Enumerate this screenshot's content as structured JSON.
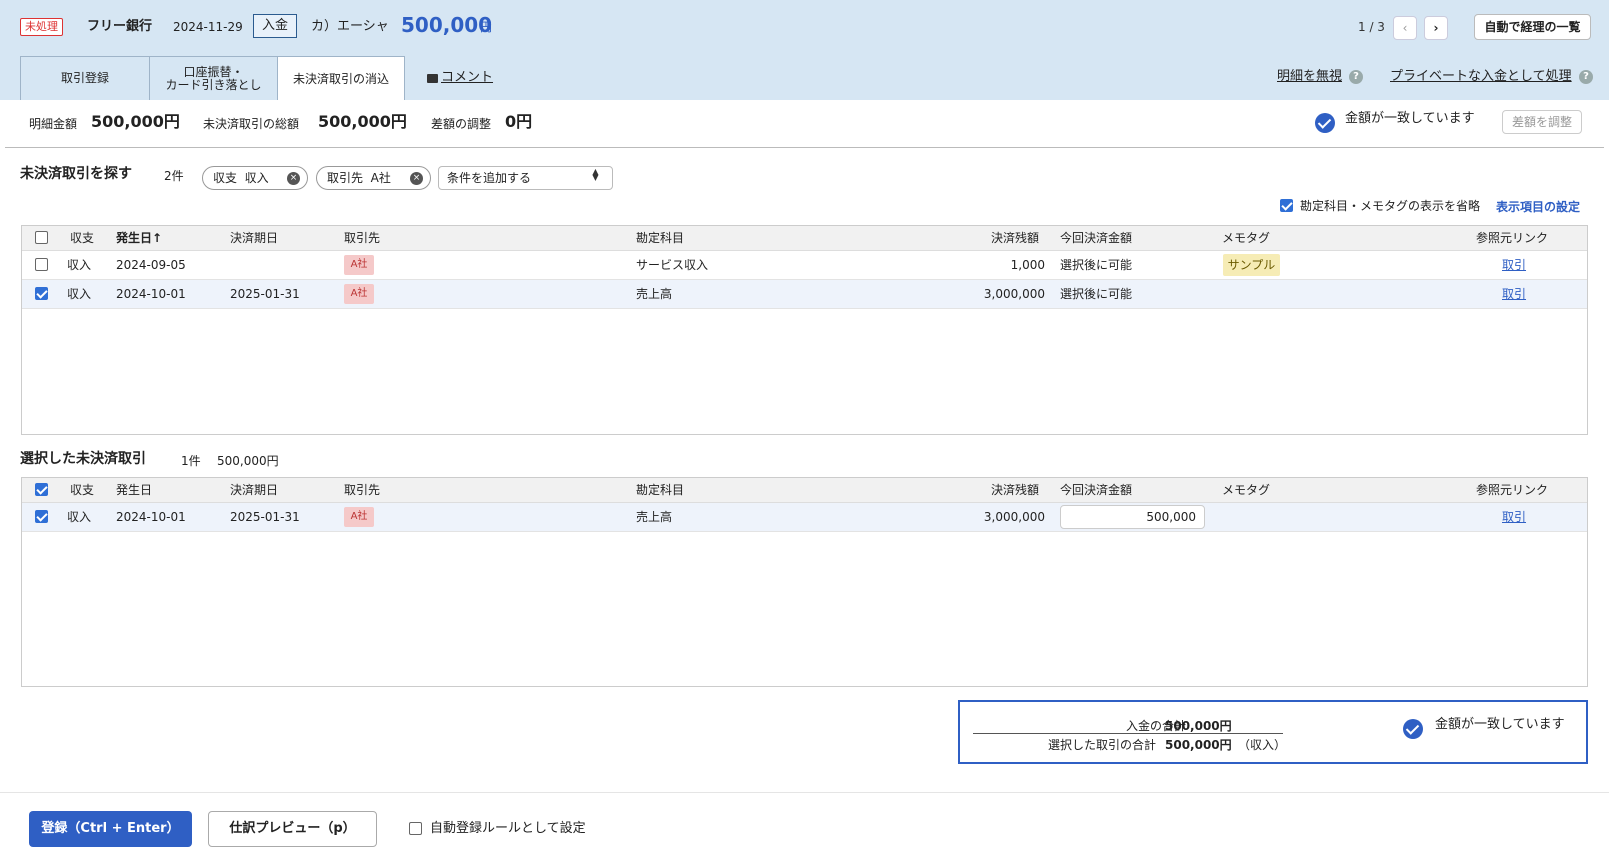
{
  "header": {
    "status_badge": "未処理",
    "bank_name": "フリー銀行",
    "date": "2024-11-29",
    "kind": "入金",
    "partner": "カ）エーシャ",
    "amount": "500,000",
    "yen": "円",
    "pager": "1 / 3",
    "prev_icon": "‹",
    "next_icon": "›",
    "list_button": "自動で経理の一覧"
  },
  "tabs": {
    "tab1": "取引登録",
    "tab2_line1": "口座振替・",
    "tab2_line2": "カード引き落とし",
    "tab3": "未決済取引の消込",
    "comment": "コメント",
    "ignore": "明細を無視",
    "private": "プライベートな入金として処理",
    "help_icon": "?"
  },
  "summary": {
    "detail_label": "明細金額",
    "detail_value": "500,000円",
    "total_label": "未決済取引の総額",
    "total_value": "500,000円",
    "diff_label": "差額の調整",
    "diff_value": "0円",
    "match_text": "金額が一致しています",
    "adjust_button": "差額を調整"
  },
  "search": {
    "title": "未決済取引を探す",
    "count": "2件",
    "chip1_label": "収支",
    "chip1_value": "収入",
    "chip2_label": "取引先",
    "chip2_value": "A社",
    "chip_remove": "×",
    "add_condition": "条件を追加する",
    "select_arrow": "▲▼",
    "omit_label": "勘定科目・メモタグの表示を省略",
    "column_setting": "表示項目の設定"
  },
  "columns": {
    "kind": "収支",
    "date": "発生日",
    "date_sort": "発生日↑",
    "due": "決済期日",
    "partner": "取引先",
    "account": "勘定科目",
    "remaining": "決済残額",
    "current": "今回決済金額",
    "memo": "メモタグ",
    "ref": "参照元リンク"
  },
  "search_rows": [
    {
      "kind": "収入",
      "date": "2024-09-05",
      "due": "",
      "partner": "A社",
      "account": "サービス収入",
      "remaining": "1,000",
      "current": "選択後に可能",
      "memo": "サンプル",
      "ref": "取引"
    },
    {
      "kind": "収入",
      "date": "2024-10-01",
      "due": "2025-01-31",
      "partner": "A社",
      "account": "売上高",
      "remaining": "3,000,000",
      "current": "選択後に可能",
      "memo": "",
      "ref": "取引"
    }
  ],
  "selected": {
    "title": "選択した未決済取引",
    "count": "1件",
    "amount": "500,000円",
    "rows": [
      {
        "kind": "収入",
        "date": "2024-10-01",
        "due": "2025-01-31",
        "partner": "A社",
        "account": "売上高",
        "remaining": "3,000,000",
        "current": "500,000",
        "memo": "",
        "ref": "取引"
      }
    ]
  },
  "totals": {
    "deposit_label": "入金の合計",
    "deposit_value": "500,000円",
    "selected_label": "選択した取引の合計",
    "selected_value": "500,000円",
    "selected_note": "（収入）",
    "match_text": "金額が一致しています"
  },
  "footer": {
    "register": "登録（Ctrl + Enter）",
    "preview": "仕訳プレビュー（p）",
    "auto_rule": "自動登録ルールとして設定"
  },
  "colors": {
    "accent": "#2f5fc4",
    "header_bg": "#d6e6f3",
    "danger": "#dd3333"
  }
}
